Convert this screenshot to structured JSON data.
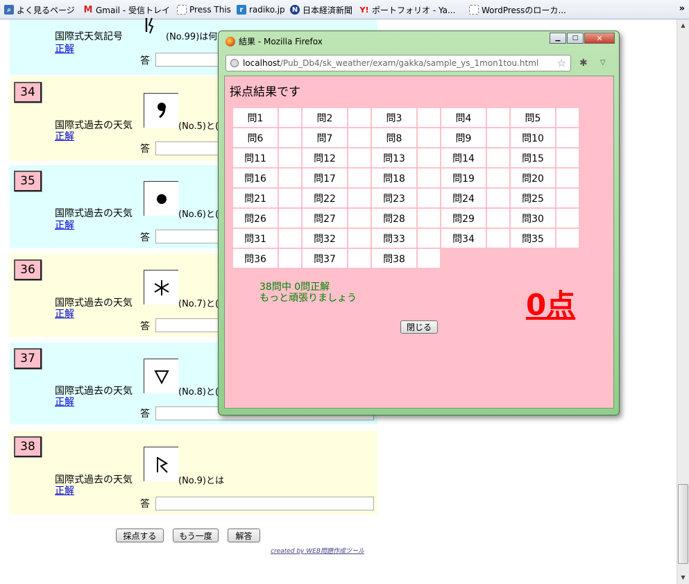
{
  "bookmarks": [
    {
      "label": "よく見るページ",
      "icon": "page-search-icon"
    },
    {
      "label": "Gmail - 受信トレイ",
      "icon": "gmail-icon"
    },
    {
      "label": "Press This",
      "icon": "blank-page-icon"
    },
    {
      "label": "radiko.jp",
      "icon": "radiko-icon"
    },
    {
      "label": "日本経済新聞",
      "icon": "nikkei-icon"
    },
    {
      "label": "ポートフォリオ - Ya...",
      "icon": "yahoo-icon"
    },
    {
      "label": "WordPressのローカ...",
      "icon": "blank-page-icon"
    }
  ],
  "bookmarks_more": "»",
  "questions": [
    {
      "num": "",
      "text": "国際式天気記号",
      "tail": "(No.99)は何",
      "link": "正解",
      "answer_label": "答"
    },
    {
      "num": "34",
      "text": "国際式過去の天気",
      "tail": "(No.5)と(",
      "link": "正解",
      "answer_label": "答"
    },
    {
      "num": "35",
      "text": "国際式過去の天気",
      "tail": "(No.6)と(",
      "link": "正解",
      "answer_label": "答"
    },
    {
      "num": "36",
      "text": "国際式過去の天気",
      "tail": "(No.7)と(",
      "link": "正解",
      "answer_label": "答"
    },
    {
      "num": "37",
      "text": "国際式過去の天気",
      "tail": "(No.8)と(",
      "link": "正解",
      "answer_label": "答"
    },
    {
      "num": "38",
      "text": "国際式過去の天気",
      "tail": "(No.9)とは",
      "link": "正解",
      "answer_label": "答"
    }
  ],
  "buttons": {
    "grade": "採点する",
    "retry": "もう一度",
    "answers": "解答"
  },
  "credit": "created by WEB問題作成ツール",
  "popup": {
    "window_title": "結果 - Mozilla Firefox",
    "url_host": "localhost",
    "url_path": "/Pub_Db4/sk_weather/exam/gakka/sample_ys_1mon1tou.html",
    "heading": "採点結果です",
    "grid_rows": [
      [
        "問1",
        "問2",
        "問3",
        "問4",
        "問5"
      ],
      [
        "問6",
        "問7",
        "問8",
        "問9",
        "問10"
      ],
      [
        "問11",
        "問12",
        "問13",
        "問14",
        "問15"
      ],
      [
        "問16",
        "問17",
        "問18",
        "問19",
        "問20"
      ],
      [
        "問21",
        "問22",
        "問23",
        "問24",
        "問25"
      ],
      [
        "問26",
        "問27",
        "問28",
        "問29",
        "問30"
      ],
      [
        "問31",
        "問32",
        "問33",
        "問34",
        "問35"
      ],
      [
        "問36",
        "問37",
        "問38"
      ]
    ],
    "summary_line1": "38問中 0問正解",
    "summary_line2": "もっと頑張りましょう",
    "score": "0点",
    "close_label": "閉じる"
  },
  "colors": {
    "cyan_block": "#e0ffff",
    "yellow_block": "#ffffe0",
    "popup_bg": "#ffc0cb",
    "score": "#ff0000",
    "summary": "#008000"
  }
}
